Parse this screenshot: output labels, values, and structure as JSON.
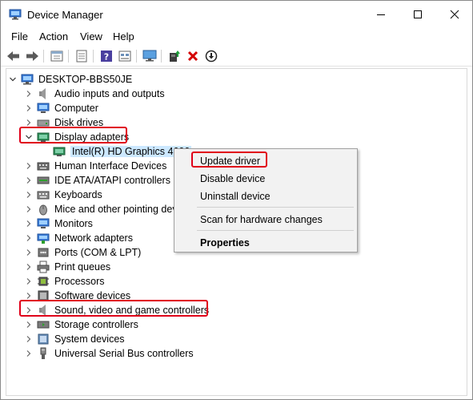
{
  "window": {
    "title": "Device Manager"
  },
  "menu": [
    "File",
    "Action",
    "View",
    "Help"
  ],
  "toolbar": {
    "icons": [
      "back-icon",
      "forward-icon",
      "properties-pane-icon",
      "show-hidden-icon",
      "help-icon",
      "view-icon",
      "monitor-icon",
      "add-driver-icon",
      "uninstall-icon",
      "download-icon"
    ]
  },
  "tree": {
    "root": "DESKTOP-BBS50JE",
    "categories": [
      "Audio inputs and outputs",
      "Computer",
      "Disk drives",
      "Display adapters",
      "Human Interface Devices",
      "IDE ATA/ATAPI controllers",
      "Keyboards",
      "Mice and other pointing devices",
      "Monitors",
      "Network adapters",
      "Ports (COM & LPT)",
      "Print queues",
      "Processors",
      "Software devices",
      "Sound, video and game controllers",
      "Storage controllers",
      "System devices",
      "Universal Serial Bus controllers"
    ],
    "display_adapter_child": "Intel(R) HD Graphics 4600"
  },
  "context_menu": {
    "items": [
      "Update driver",
      "Disable device",
      "Uninstall device",
      "Scan for hardware changes",
      "Properties"
    ]
  },
  "colors": {
    "highlight": "#e0001a",
    "selection": "#cce8ff",
    "uninstall_x": "#d40000"
  }
}
